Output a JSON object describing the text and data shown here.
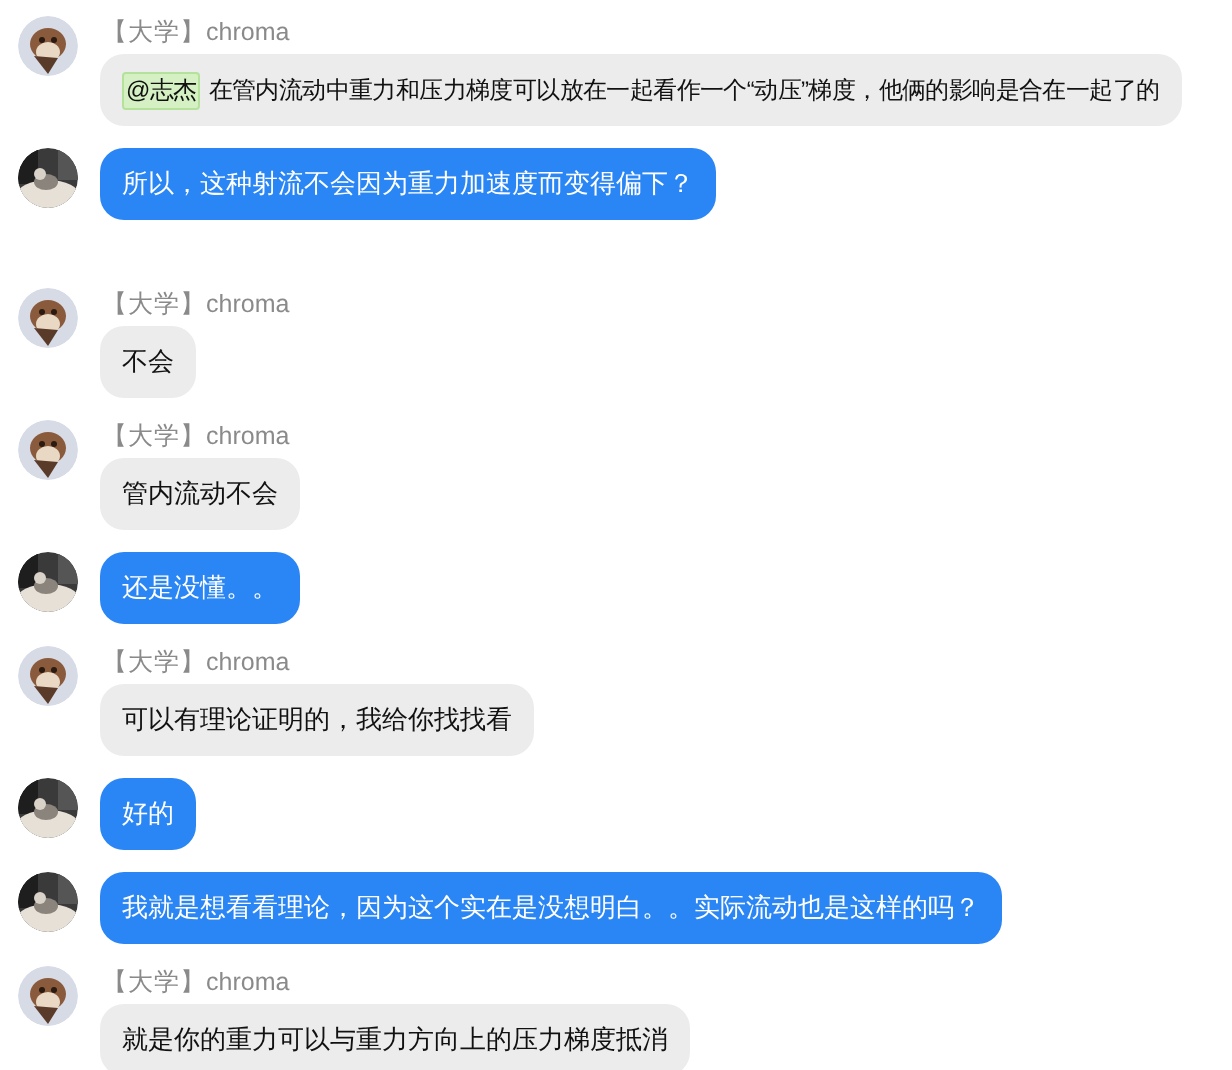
{
  "messages": [
    {
      "kind": "received",
      "sender": "【大学】chroma",
      "mention": "@志杰",
      "text": "在管内流动中重力和压力梯度可以放在一起看作一个“动压”梯度，他俩的影响是合在一起了的"
    },
    {
      "kind": "sent",
      "text": "所以，这种射流不会因为重力加速度而变得偏下？"
    },
    {
      "kind": "received",
      "sender": "【大学】chroma",
      "text": "不会"
    },
    {
      "kind": "received",
      "sender": "【大学】chroma",
      "text": "管内流动不会"
    },
    {
      "kind": "sent",
      "text": "还是没懂。。"
    },
    {
      "kind": "received",
      "sender": "【大学】chroma",
      "text": "可以有理论证明的，我给你找找看"
    },
    {
      "kind": "sent",
      "text": "好的"
    },
    {
      "kind": "sent",
      "text": "我就是想看看理论，因为这个实在是没想明白。。实际流动也是这样的吗？"
    },
    {
      "kind": "received",
      "sender": "【大学】chroma",
      "text": "就是你的重力可以与重力方向上的压力梯度抵消"
    }
  ]
}
